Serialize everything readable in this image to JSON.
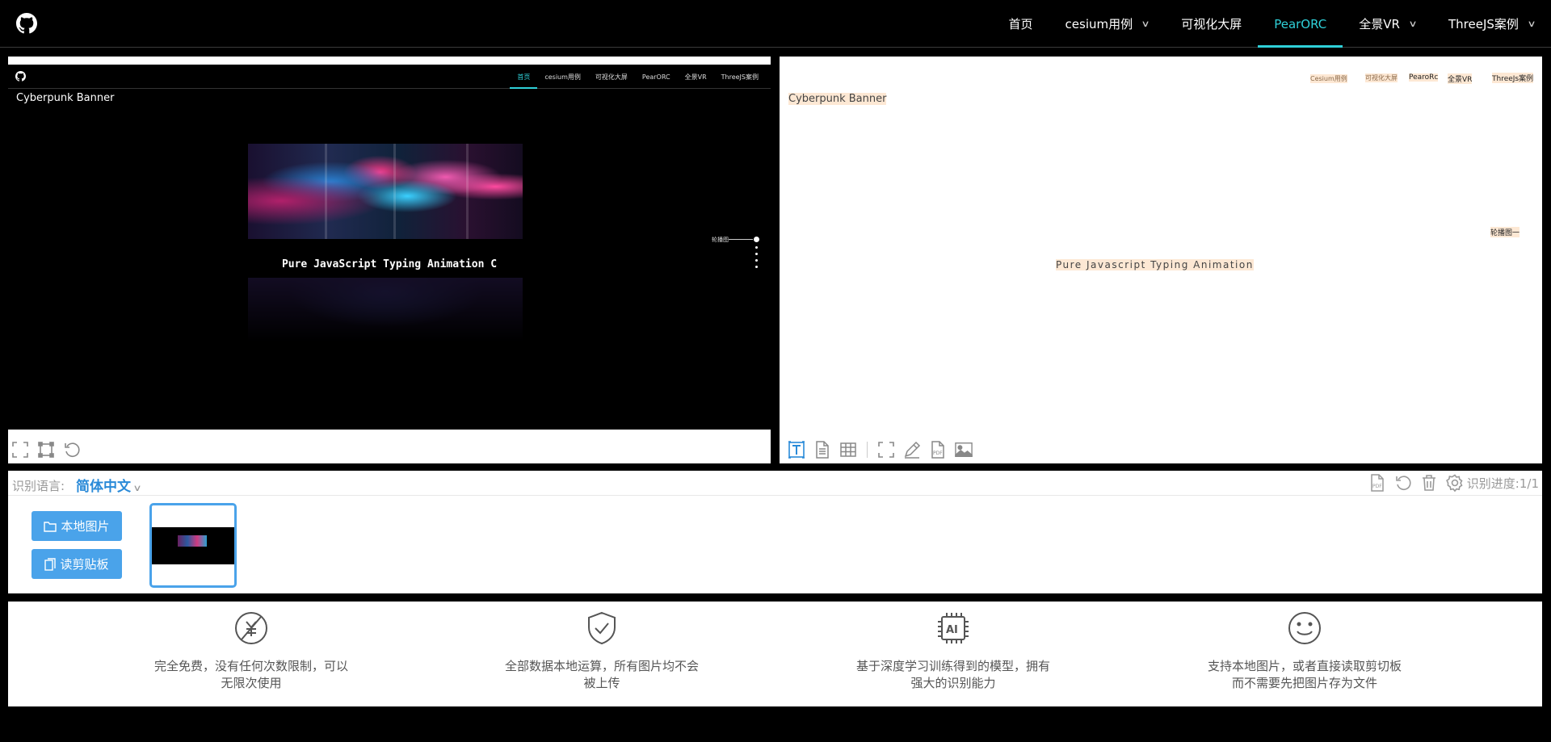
{
  "nav": {
    "items": [
      {
        "label": "首页",
        "dropdown": false,
        "active": false
      },
      {
        "label": "cesium用例",
        "dropdown": true,
        "active": false
      },
      {
        "label": "可视化大屏",
        "dropdown": false,
        "active": false
      },
      {
        "label": "PearORC",
        "dropdown": false,
        "active": true
      },
      {
        "label": "全景VR",
        "dropdown": true,
        "active": false
      },
      {
        "label": "ThreeJS案例",
        "dropdown": true,
        "active": false
      }
    ],
    "accent": "#2fd0d8"
  },
  "preview": {
    "nav_items": [
      "首页",
      "cesium用例",
      "可视化大屏",
      "PearORC",
      "全景VR",
      "ThreeJS案例"
    ],
    "title": "Cyberpunk Banner",
    "typing_text": "Pure JavaScript Typing Animation C",
    "carousel_label": "轮播图一"
  },
  "result": {
    "words": [
      {
        "text": "Cesium用例"
      },
      {
        "text": "可视化大屏"
      },
      {
        "text": "PearoRc"
      },
      {
        "text": "全景VR"
      },
      {
        "text": "ThreeJs案例"
      },
      {
        "text": "Cyberpunk Banner"
      },
      {
        "text": "轮播图一"
      },
      {
        "text": "Pure Javascript Typing Animation"
      }
    ],
    "highlight_color": "#fde8d4"
  },
  "controls": {
    "lang_label": "识别语言:",
    "lang_value": "简体中文",
    "progress": "识别进度:1/1",
    "local_image_button": "本地图片",
    "clipboard_button": "读剪贴板",
    "button_color": "#4aa3ea"
  },
  "features": [
    {
      "icon": "no-money-icon",
      "text": "完全免费，没有任何次数限制，可以无限次使用"
    },
    {
      "icon": "shield-check-icon",
      "text": "全部数据本地运算，所有图片均不会被上传"
    },
    {
      "icon": "ai-chip-icon",
      "text": "基于深度学习训练得到的模型，拥有强大的识别能力"
    },
    {
      "icon": "smile-icon",
      "text": "支持本地图片，或者直接读取剪切板而不需要先把图片存为文件"
    }
  ]
}
